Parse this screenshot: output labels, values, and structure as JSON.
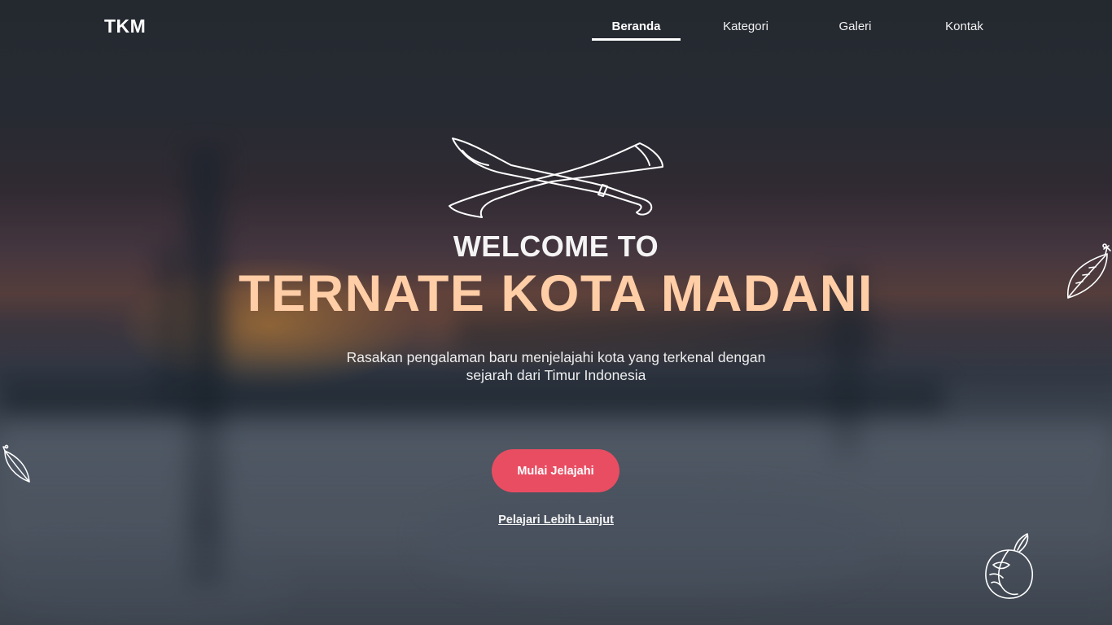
{
  "header": {
    "logo": "TKM",
    "nav": [
      {
        "label": "Beranda",
        "active": true
      },
      {
        "label": "Kategori",
        "active": false
      },
      {
        "label": "Galeri",
        "active": false
      },
      {
        "label": "Kontak",
        "active": false
      }
    ]
  },
  "hero": {
    "welcome": "WELCOME TO",
    "title": "TERNATE KOTA MADANI",
    "subtitle_line1": "Rasakan pengalaman baru menjelajahi kota yang terkenal dengan",
    "subtitle_line2": "sejarah dari Timur Indonesia",
    "primary_button": "Mulai Jelajahi",
    "secondary_link": "Pelajari Lebih Lanjut"
  },
  "icons": {
    "emblem": "crossed-swords-icon",
    "leaf_right": "clove-leaf-icon",
    "leaf_left": "clove-leaf-icon",
    "fruit": "nutmeg-icon"
  },
  "colors": {
    "accent_button": "#e94d62",
    "title_peach": "#ffcda6",
    "text": "#ffffff"
  }
}
